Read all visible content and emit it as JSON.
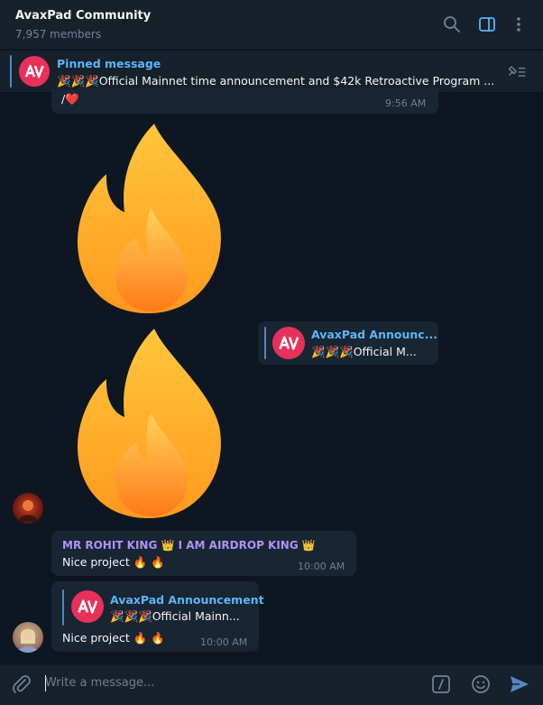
{
  "header": {
    "title": "AvaxPad Community",
    "members": "7,957 members"
  },
  "pinned": {
    "label": "Pinned message",
    "text": "🎉🎉🎉Official Mainnet time announcement and $42k Retroactive Program ..."
  },
  "messages": [
    {
      "text": "/❤️",
      "time": "9:56 AM"
    },
    {
      "reply_title": "AvaxPad Announc...",
      "reply_text": "🎉🎉🎉Official M..."
    },
    {
      "sender": "MR ROHIT KING 👑 I AM AIRDROP KING 👑",
      "text": "Nice project 🔥 🔥",
      "time": "10:00 AM"
    },
    {
      "reply_title": "AvaxPad Announcement",
      "reply_text": "🎉🎉🎉Official Mainn...",
      "text": "Nice project 🔥 🔥",
      "time": "10:00 AM"
    }
  ],
  "input": {
    "placeholder": "Write a message..."
  },
  "colors": {
    "background": "#0e1621",
    "panel": "#17212b",
    "bubble": "#182533",
    "accent": "#5eb5f7",
    "sender": "#b192f8",
    "brand": "#e8315a"
  }
}
